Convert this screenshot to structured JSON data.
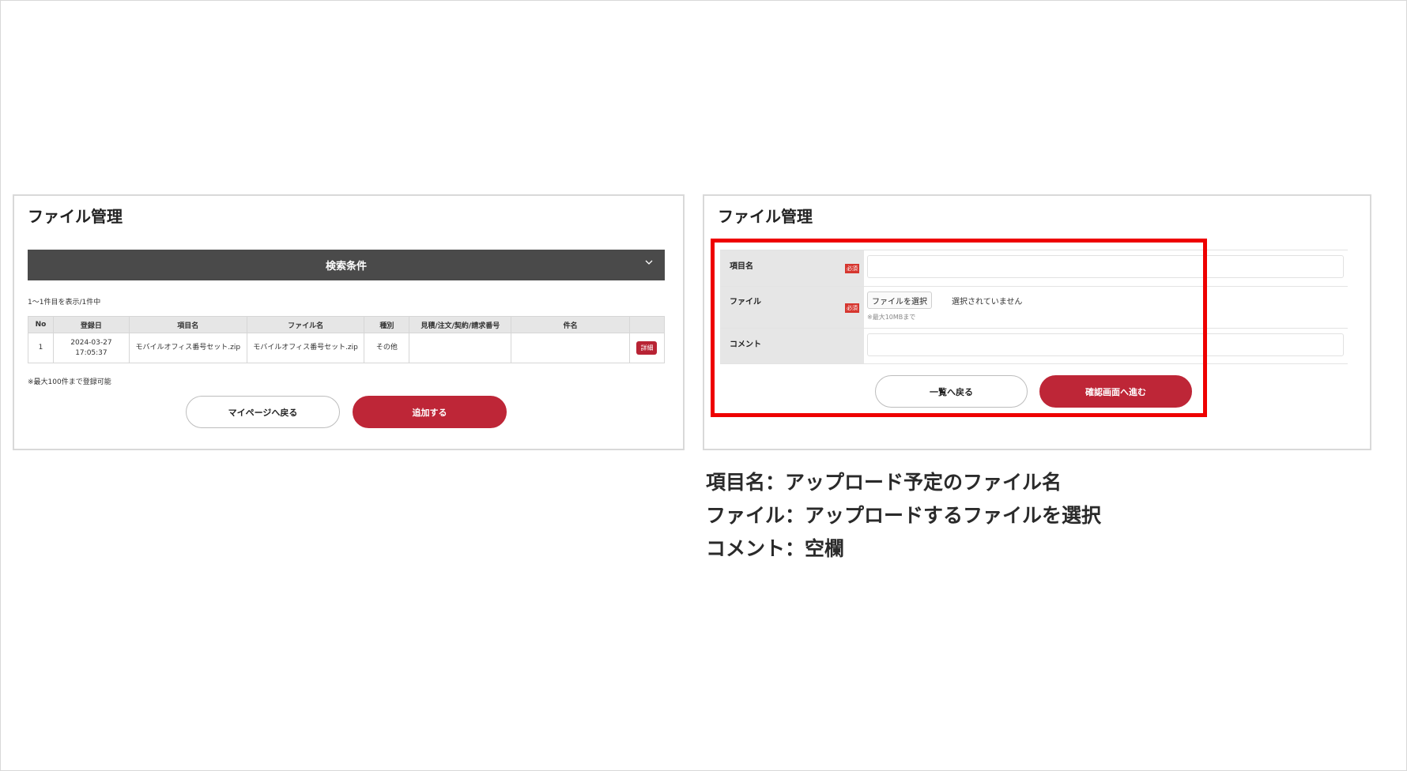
{
  "left_panel": {
    "title": "ファイル管理",
    "search_bar_label": "検索条件",
    "result_count": "1〜1件目を表示/1件中",
    "table": {
      "headers": [
        "No",
        "登録日",
        "項目名",
        "ファイル名",
        "種別",
        "見積/注文/契約/請求番号",
        "件名",
        ""
      ],
      "rows": [
        {
          "no": "1",
          "date": "2024-03-27",
          "time": "17:05:37",
          "item_name": "モバイルオフィス番号セット.zip",
          "file_name": "モバイルオフィス番号セット.zip",
          "type": "その他",
          "number": "",
          "subject": "",
          "action": "詳細"
        }
      ]
    },
    "max_note": "※最大100件まで登録可能",
    "back_button": "マイページへ戻る",
    "add_button": "追加する"
  },
  "right_panel": {
    "title": "ファイル管理",
    "fields": {
      "item_name_label": "項目名",
      "item_name_required": "必須",
      "item_name_value": "",
      "file_label": "ファイル",
      "file_required": "必須",
      "file_button": "ファイルを選択",
      "file_status": "選択されていません",
      "file_hint": "※最大10MBまで",
      "comment_label": "コメント",
      "comment_value": ""
    },
    "back_button": "一覧へ戻る",
    "confirm_button": "確認画面へ進む"
  },
  "captions": [
    "項目名：アップロード予定のファイル名",
    "ファイル：アップロードするファイルを選択",
    "コメント：空欄"
  ],
  "colors": {
    "accent_red": "#be2637",
    "highlight_red": "#ee0000",
    "search_bar_bg": "#4a4a4a",
    "required_badge": "#d6362f"
  },
  "icons": {
    "search_toggle": "chevron-down-icon"
  }
}
